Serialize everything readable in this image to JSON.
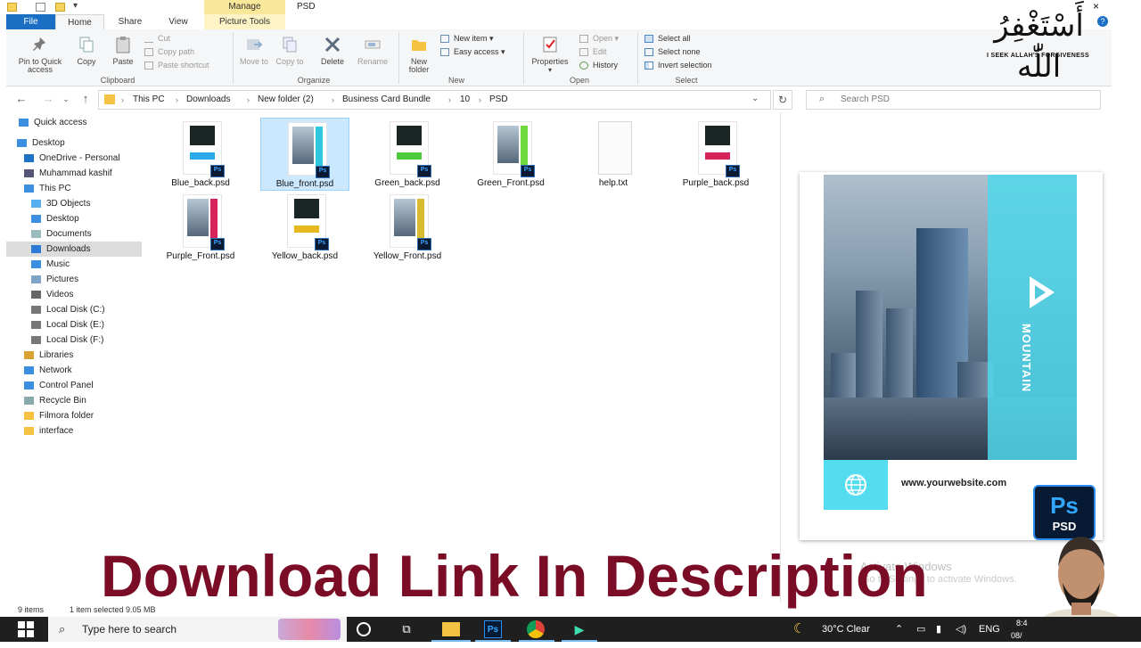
{
  "window": {
    "title": "PSD",
    "manage_tab": "Manage"
  },
  "ribbon_tabs": {
    "file": "File",
    "home": "Home",
    "share": "Share",
    "view": "View",
    "picture_tools": "Picture Tools"
  },
  "ribbon": {
    "clipboard": {
      "pin": "Pin to Quick access",
      "copy": "Copy",
      "paste": "Paste",
      "cut": "Cut",
      "copy_path": "Copy path",
      "paste_shortcut": "Paste shortcut",
      "label": "Clipboard"
    },
    "organize": {
      "move_to": "Move to",
      "copy_to": "Copy to",
      "delete": "Delete",
      "rename": "Rename",
      "label": "Organize"
    },
    "new": {
      "new_folder": "New folder",
      "new_item": "New item",
      "easy_access": "Easy access",
      "label": "New"
    },
    "open": {
      "properties": "Properties",
      "open": "Open",
      "edit": "Edit",
      "history": "History",
      "label": "Open"
    },
    "select": {
      "select_all": "Select all",
      "select_none": "Select none",
      "invert": "Invert selection",
      "label": "Select"
    }
  },
  "overlay": {
    "arabic": "أَسْتَغْفِرُ اللّٰه",
    "arabic_sub": "I SEEK ALLAH'S FORGIVENESS",
    "headline": "Download Link In Description",
    "watermark": "Activate Windows",
    "watermark_sub": "Go to Settings to activate Windows."
  },
  "address": {
    "crumbs": [
      "This PC",
      "Downloads",
      "New folder (2)",
      "Business Card Bundle",
      "10",
      "PSD"
    ],
    "search_placeholder": "Search PSD"
  },
  "nav": {
    "items": [
      {
        "label": "Quick access",
        "icon": "star-icon"
      },
      {
        "label": "Desktop",
        "icon": "desktop-icon"
      },
      {
        "label": "OneDrive - Personal",
        "icon": "cloud-icon"
      },
      {
        "label": "Muhammad kashif",
        "icon": "user-icon"
      },
      {
        "label": "This PC",
        "icon": "computer-icon"
      },
      {
        "label": "3D Objects",
        "icon": "cube-icon"
      },
      {
        "label": "Desktop",
        "icon": "desktop-icon"
      },
      {
        "label": "Documents",
        "icon": "document-icon"
      },
      {
        "label": "Downloads",
        "icon": "download-icon"
      },
      {
        "label": "Music",
        "icon": "music-icon"
      },
      {
        "label": "Pictures",
        "icon": "pictures-icon"
      },
      {
        "label": "Videos",
        "icon": "video-icon"
      },
      {
        "label": "Local Disk (C:)",
        "icon": "drive-icon"
      },
      {
        "label": "Local Disk (E:)",
        "icon": "drive-icon"
      },
      {
        "label": "Local Disk (F:)",
        "icon": "drive-icon"
      },
      {
        "label": "Libraries",
        "icon": "library-icon"
      },
      {
        "label": "Network",
        "icon": "network-icon"
      },
      {
        "label": "Control Panel",
        "icon": "control-panel-icon"
      },
      {
        "label": "Recycle Bin",
        "icon": "recycle-bin-icon"
      },
      {
        "label": "Filmora folder",
        "icon": "folder-icon"
      },
      {
        "label": "interface",
        "icon": "folder-icon"
      }
    ]
  },
  "files": [
    {
      "name": "Blue_back.psd",
      "color": "#2aa9e8",
      "kind": "back"
    },
    {
      "name": "Blue_front.psd",
      "color": "#2fc7e0",
      "kind": "front"
    },
    {
      "name": "Green_back.psd",
      "color": "#4ccc3d",
      "kind": "back"
    },
    {
      "name": "Green_Front.psd",
      "color": "#6ddb3d",
      "kind": "front"
    },
    {
      "name": "help.txt",
      "color": "#cccccc",
      "kind": "txt"
    },
    {
      "name": "Purple_back.psd",
      "color": "#d6245b",
      "kind": "back"
    },
    {
      "name": "Purple_Front.psd",
      "color": "#d6245b",
      "kind": "front"
    },
    {
      "name": "Yellow_back.psd",
      "color": "#e6b71e",
      "kind": "back"
    },
    {
      "name": "Yellow_Front.psd",
      "color": "#d9bb31",
      "kind": "front"
    }
  ],
  "preview": {
    "brand": "MOUNTAIN",
    "url": "www.yourwebsite.com",
    "ps_badge": "Ps",
    "ps_label": "PSD"
  },
  "status": {
    "count": "9 items",
    "selected": "1 item selected  9.05 MB"
  },
  "taskbar": {
    "search_placeholder": "Type here to search",
    "weather": "30°C  Clear",
    "lang": "ENG",
    "time": "8:4",
    "date": "08/"
  }
}
